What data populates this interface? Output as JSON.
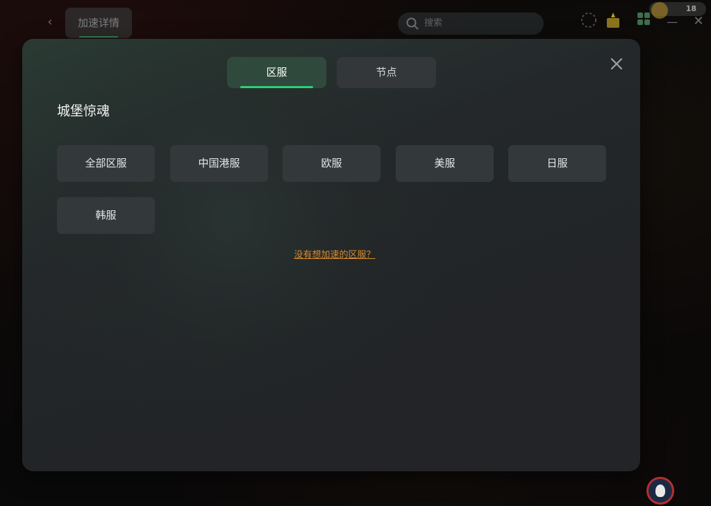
{
  "background_app": {
    "page_tab_label": "加速详情",
    "search_placeholder": "搜索",
    "coin_count": "18"
  },
  "modal": {
    "tabs": [
      {
        "label": "区服",
        "active": true
      },
      {
        "label": "节点",
        "active": false
      }
    ],
    "game_title": "城堡惊魂",
    "regions": [
      {
        "label": "全部区服"
      },
      {
        "label": "中国港服"
      },
      {
        "label": "欧服"
      },
      {
        "label": "美服"
      },
      {
        "label": "日服"
      },
      {
        "label": "韩服"
      }
    ],
    "help_link": "没有想加速的区服？",
    "accent_color": "#2fd07a",
    "link_color": "#d98a2a"
  }
}
